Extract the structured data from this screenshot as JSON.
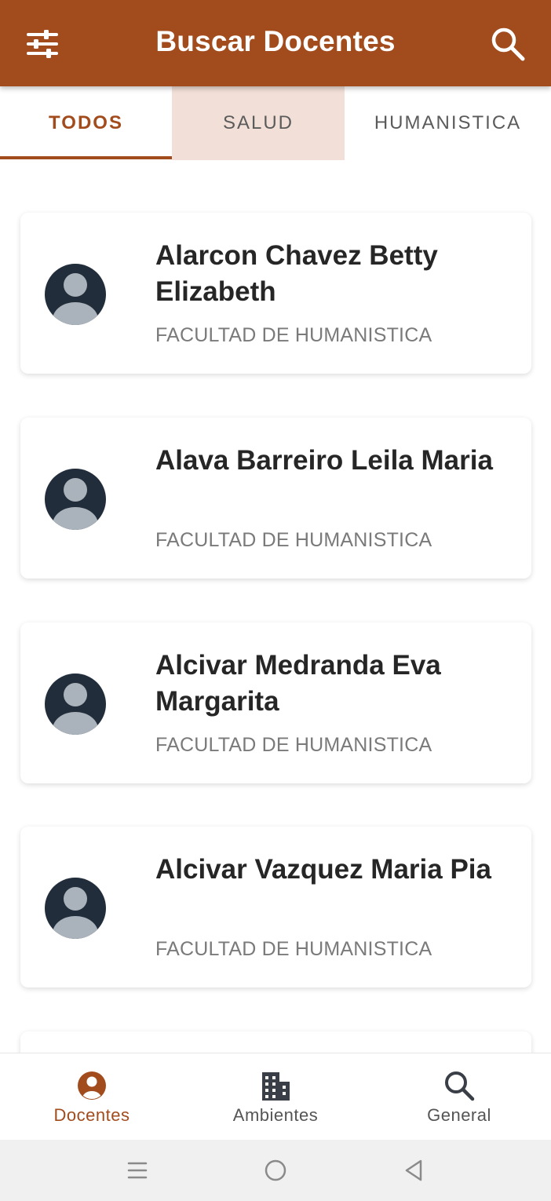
{
  "appbar": {
    "title": "Buscar Docentes",
    "left_icon": "filter-sliders-icon",
    "right_icon": "search-icon",
    "color": "#a24c1e"
  },
  "tabs": [
    {
      "label": "TODOS",
      "selected": true
    },
    {
      "label": "SALUD",
      "selected": false
    },
    {
      "label": "HUMANISTICA",
      "selected": false
    }
  ],
  "teachers": [
    {
      "name": "Alarcon Chavez Betty Elizabeth",
      "faculty": "FACULTAD DE HUMANISTICA"
    },
    {
      "name": "Alava Barreiro Leila Maria",
      "faculty": "FACULTAD DE HUMANISTICA"
    },
    {
      "name": "Alcivar Medranda Eva Margarita",
      "faculty": "FACULTAD DE HUMANISTICA"
    },
    {
      "name": "Alcivar Vazquez Maria Pia",
      "faculty": "FACULTAD DE HUMANISTICA"
    }
  ],
  "bottom_nav": [
    {
      "label": "Docentes",
      "icon": "person-circle-icon",
      "active": true
    },
    {
      "label": "Ambientes",
      "icon": "building-icon",
      "active": false
    },
    {
      "label": "General",
      "icon": "search-icon",
      "active": false
    }
  ],
  "system_nav": [
    "recent-apps-icon",
    "home-icon",
    "back-icon"
  ]
}
